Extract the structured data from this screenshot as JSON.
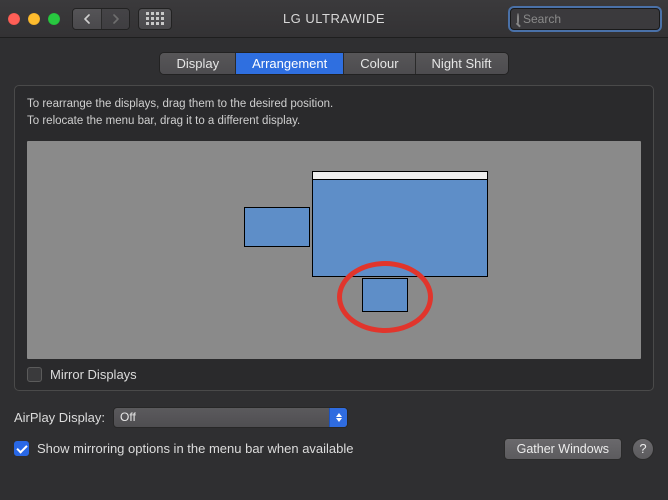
{
  "window": {
    "title": "LG ULTRAWIDE"
  },
  "search": {
    "placeholder": "Search",
    "value": ""
  },
  "tabs": {
    "display": "Display",
    "arrangement": "Arrangement",
    "colour": "Colour",
    "nightshift": "Night Shift",
    "active": "arrangement"
  },
  "instructions": {
    "line1": "To rearrange the displays, drag them to the desired position.",
    "line2": "To relocate the menu bar, drag it to a different display."
  },
  "displays": {
    "main": {
      "name": "main-display",
      "menubar": true
    },
    "left": {
      "name": "left-display",
      "menubar": false
    },
    "laptop": {
      "name": "laptop-display",
      "menubar": false
    }
  },
  "mirror": {
    "label": "Mirror Displays",
    "checked": false
  },
  "airplay": {
    "label": "AirPlay Display:",
    "value": "Off"
  },
  "show_mirror_options": {
    "label": "Show mirroring options in the menu bar when available",
    "checked": true
  },
  "buttons": {
    "gather": "Gather Windows",
    "help": "?"
  },
  "colors": {
    "accent": "#2f6fe0",
    "display_fill": "#5e8ec8",
    "annotation": "#e1352c"
  }
}
